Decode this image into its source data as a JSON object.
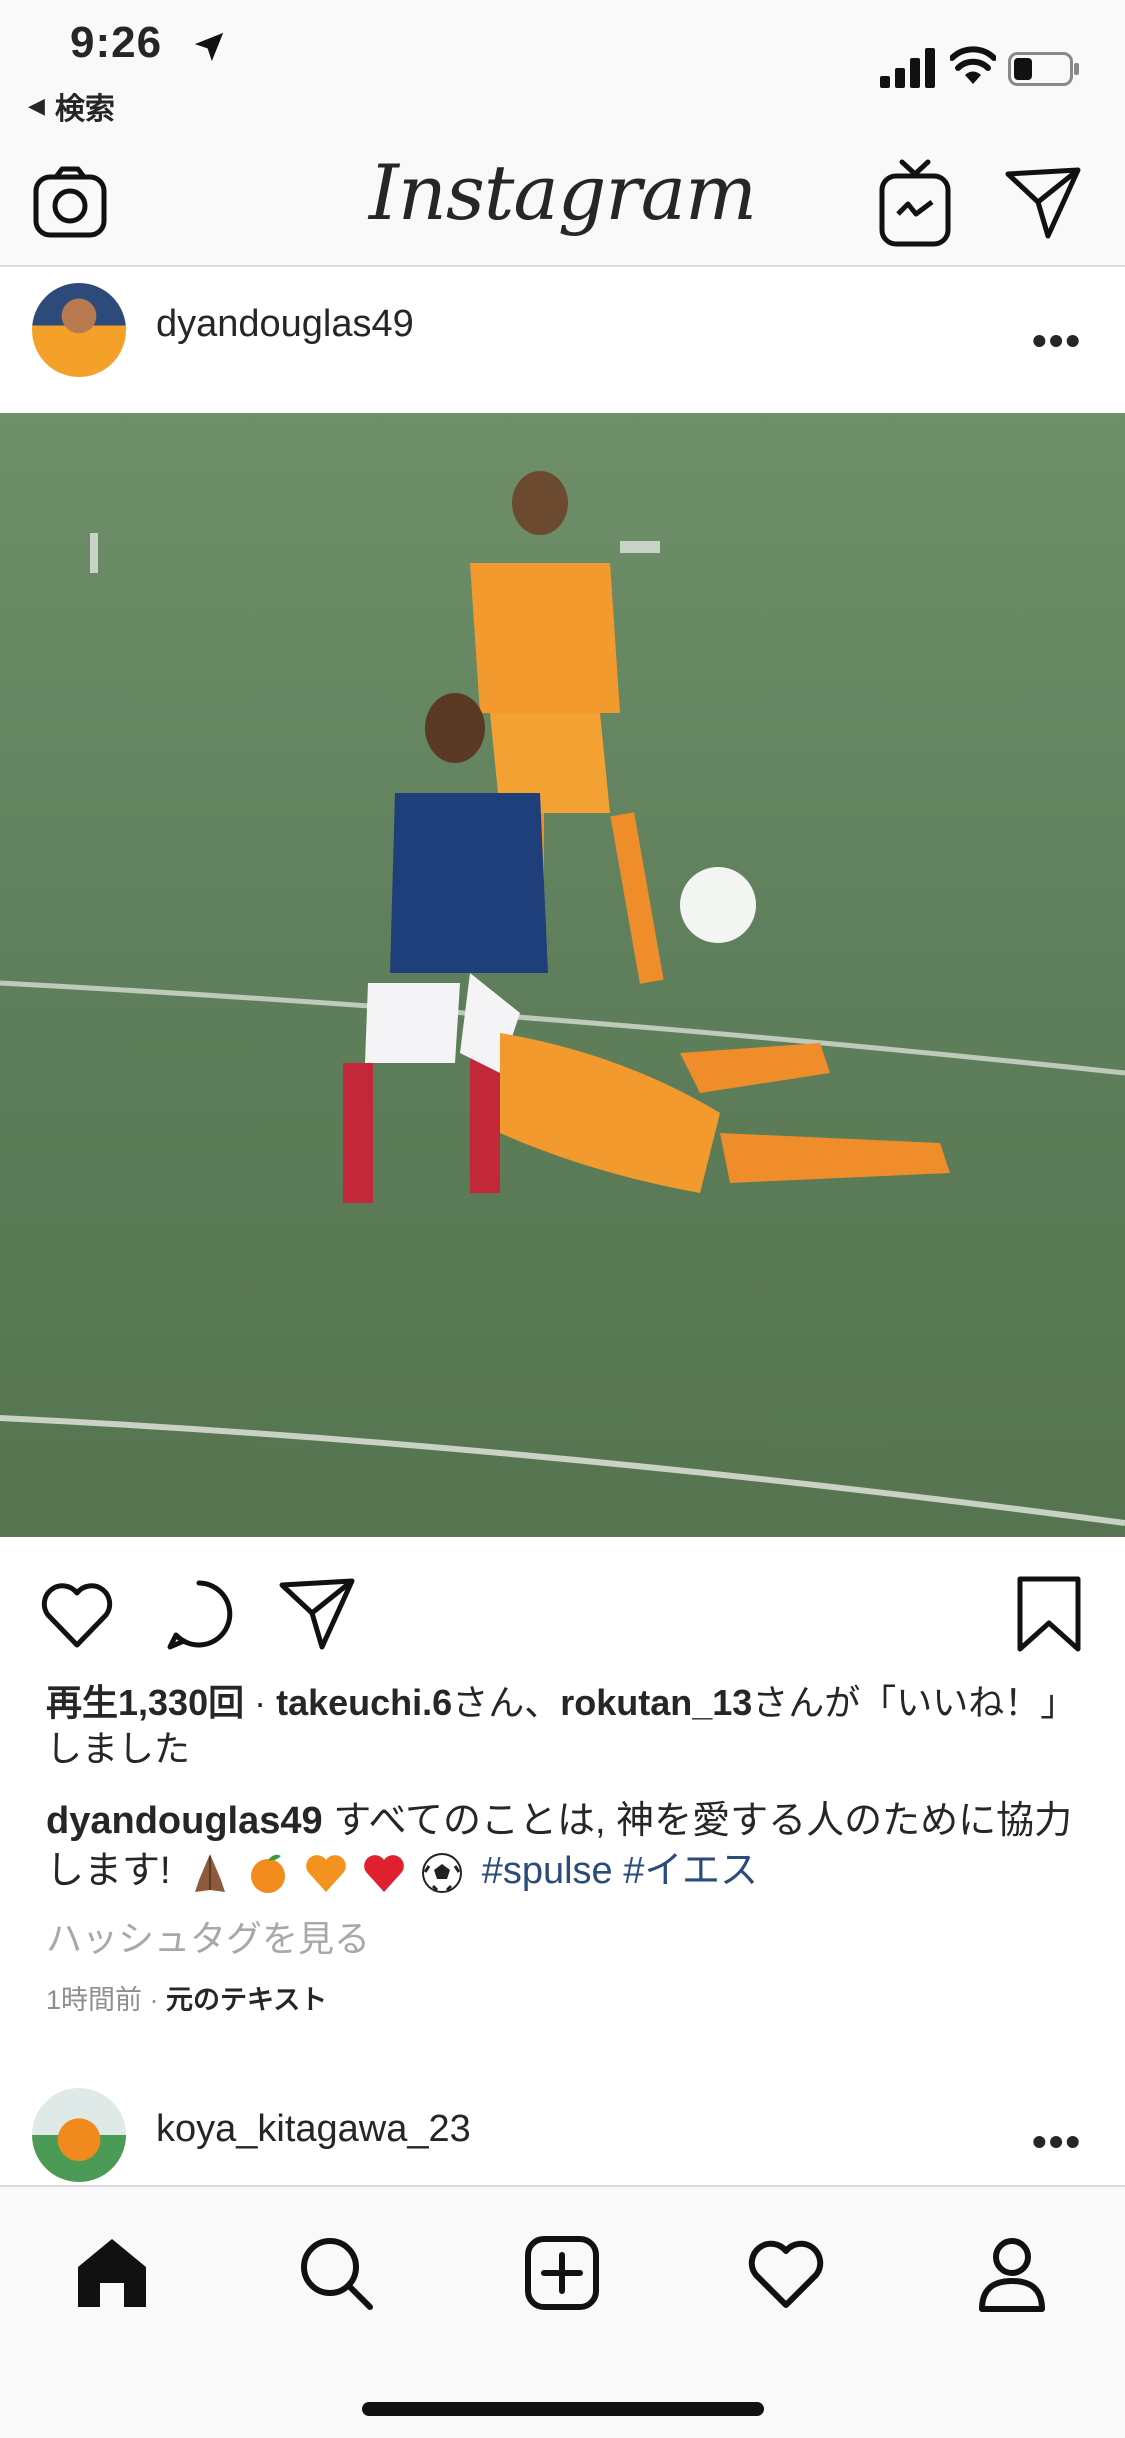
{
  "status_bar": {
    "time": "9:26",
    "back_label": "検索",
    "icons": [
      "location-arrow-icon",
      "cellular-signal-icon",
      "wifi-icon",
      "battery-icon"
    ]
  },
  "top_nav": {
    "logo": "Instagram",
    "icons": [
      "camera-icon",
      "igtv-icon",
      "direct-message-icon"
    ]
  },
  "post": {
    "username": "dyandouglas49",
    "more_label": "•••",
    "actions": [
      "heart-icon",
      "comment-icon",
      "share-icon",
      "bookmark-icon"
    ],
    "views_text": "再生1,330回",
    "separator": " · ",
    "liker_1": "takeuchi.6",
    "mid_text": "さん、",
    "liker_2": "rokutan_13",
    "end_text": "さんが「いいね！」しました",
    "caption_username": "dyandouglas49",
    "caption_text": " すべてのことは, 神を愛する人のために協力します! ",
    "caption_emojis": [
      "folded-hands-emoji",
      "tangerine-emoji",
      "orange-heart-emoji",
      "red-heart-emoji",
      "soccer-ball-emoji"
    ],
    "hashtag_1": "#spulse",
    "hashtag_2": "#イエス",
    "see_hashtags": "ハッシュタグを見る",
    "time_ago": "1時間前",
    "meta_sep": " · ",
    "original_text_link": "元のテキスト"
  },
  "next_post": {
    "username": "koya_kitagawa_23",
    "more_label": "•••"
  },
  "tab_bar": {
    "tabs": [
      "home-icon",
      "search-icon",
      "new-post-icon",
      "activity-heart-icon",
      "profile-icon"
    ]
  },
  "colors": {
    "text": "#262626",
    "hashtag": "#2b4b7b",
    "muted": "#8e8e8e",
    "bar_bg": "#f9f9f9",
    "pitch": "#5d7d5a",
    "kit_orange": "#f29a2e",
    "kit_blue": "#1f3f7a"
  }
}
